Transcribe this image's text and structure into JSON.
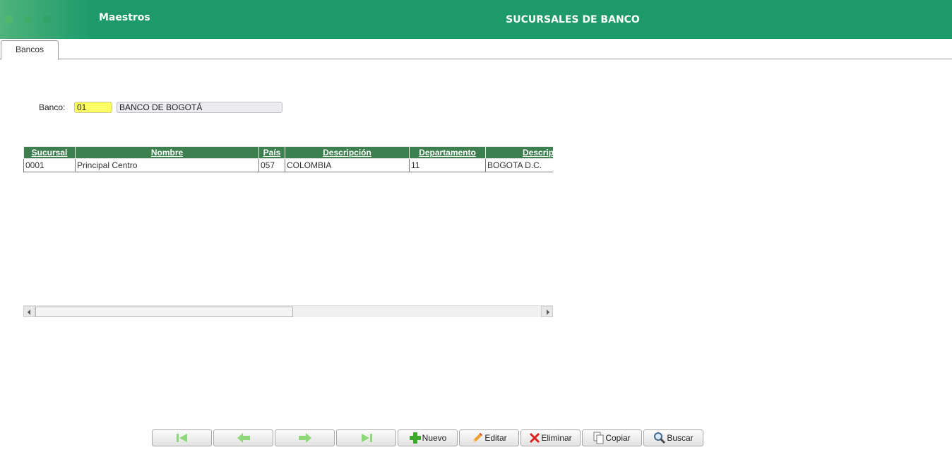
{
  "header": {
    "left_title": "Maestros",
    "title": "SUCURSALES DE BANCO"
  },
  "tabs": [
    {
      "label": "Bancos"
    }
  ],
  "form": {
    "banco_label": "Banco:",
    "banco_code": "01",
    "banco_name": "BANCO DE BOGOTÁ"
  },
  "grid": {
    "columns": [
      "Sucursal",
      "Nombre",
      "País",
      "Descripción",
      "Departamento",
      "Descripción"
    ],
    "rows": [
      [
        "0001",
        "Principal Centro",
        "057",
        "COLOMBIA",
        "11",
        "BOGOTA D.C."
      ]
    ]
  },
  "toolbar": {
    "first": "first-icon",
    "prev": "prev-icon",
    "next": "next-icon",
    "last": "last-icon",
    "nuevo": "Nuevo",
    "editar": "Editar",
    "eliminar": "Eliminar",
    "copiar": "Copiar",
    "buscar": "Buscar"
  },
  "colors": {
    "header": "#1e9a6a",
    "grid_header": "#3d7f4f",
    "code_field": "#ffff66",
    "nav_arrow": "#8fd87a"
  }
}
